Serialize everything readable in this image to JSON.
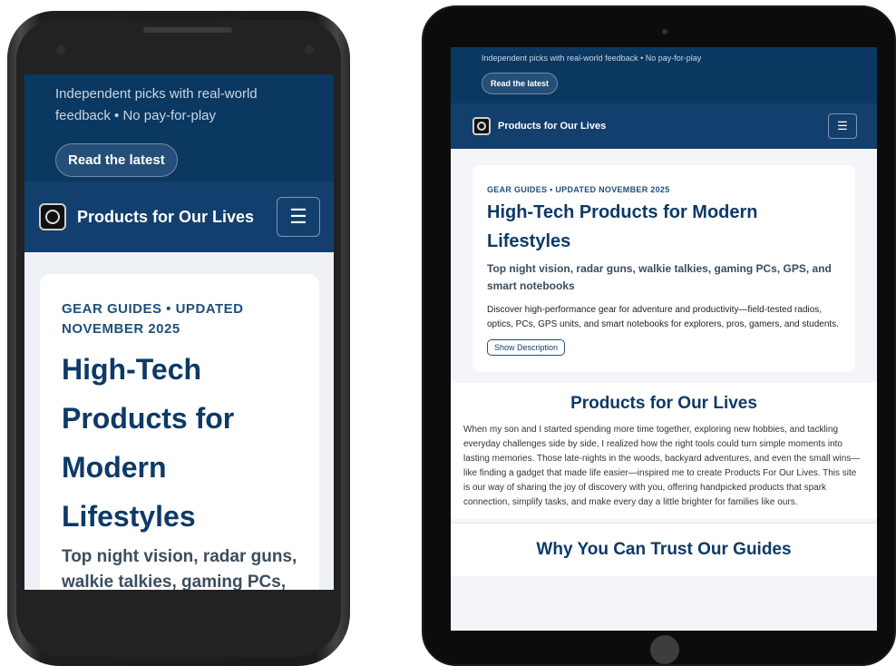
{
  "site": {
    "tagline": "Independent picks with real-world feedback • No pay-for-play",
    "cta_label": "Read the latest",
    "brand": "Products for Our Lives",
    "menu_glyph": "☰"
  },
  "hero": {
    "kicker_phone": "GEAR GUIDES • UPDATED NOVEMBER 2025",
    "kicker_tablet": "GEAR GUIDES • UPDATED NOVEMBER 2025",
    "title": "High-Tech Products for Modern Lifestyles",
    "subtitle": "Top night vision, radar guns, walkie talkies, gaming PCs, GPS, and smart notebooks",
    "subtitle_phone_visible": "Top night vision, radar guns, walkie talkies, gaming PCs,",
    "description": "Discover high-performance gear for adventure and productivity—field-tested radios, optics, PCs, GPS units, and smart notebooks for explorers, pros, gamers, and students.",
    "show_description_label": "Show Description"
  },
  "about": {
    "heading": "Products for Our Lives",
    "body": "When my son and I started spending more time together, exploring new hobbies, and tackling everyday challenges side by side, I realized how the right tools could turn simple moments into lasting memories. Those late-nights in the woods, backyard adventures, and even the small wins—like finding a gadget that made life easier—inspired me to create Products For Our Lives. This site is our way of sharing the joy of discovery with you, offering handpicked products that spark connection, simplify tasks, and make every day a little brighter for families like ours."
  },
  "trust": {
    "heading": "Why You Can Trust Our Guides"
  },
  "colors": {
    "header_bg": "#0b3861",
    "nav_bg": "#123f6d",
    "heading": "#0d3a66"
  },
  "icons": {
    "logo": "brand-logo-icon",
    "menu": "hamburger-menu-icon"
  }
}
